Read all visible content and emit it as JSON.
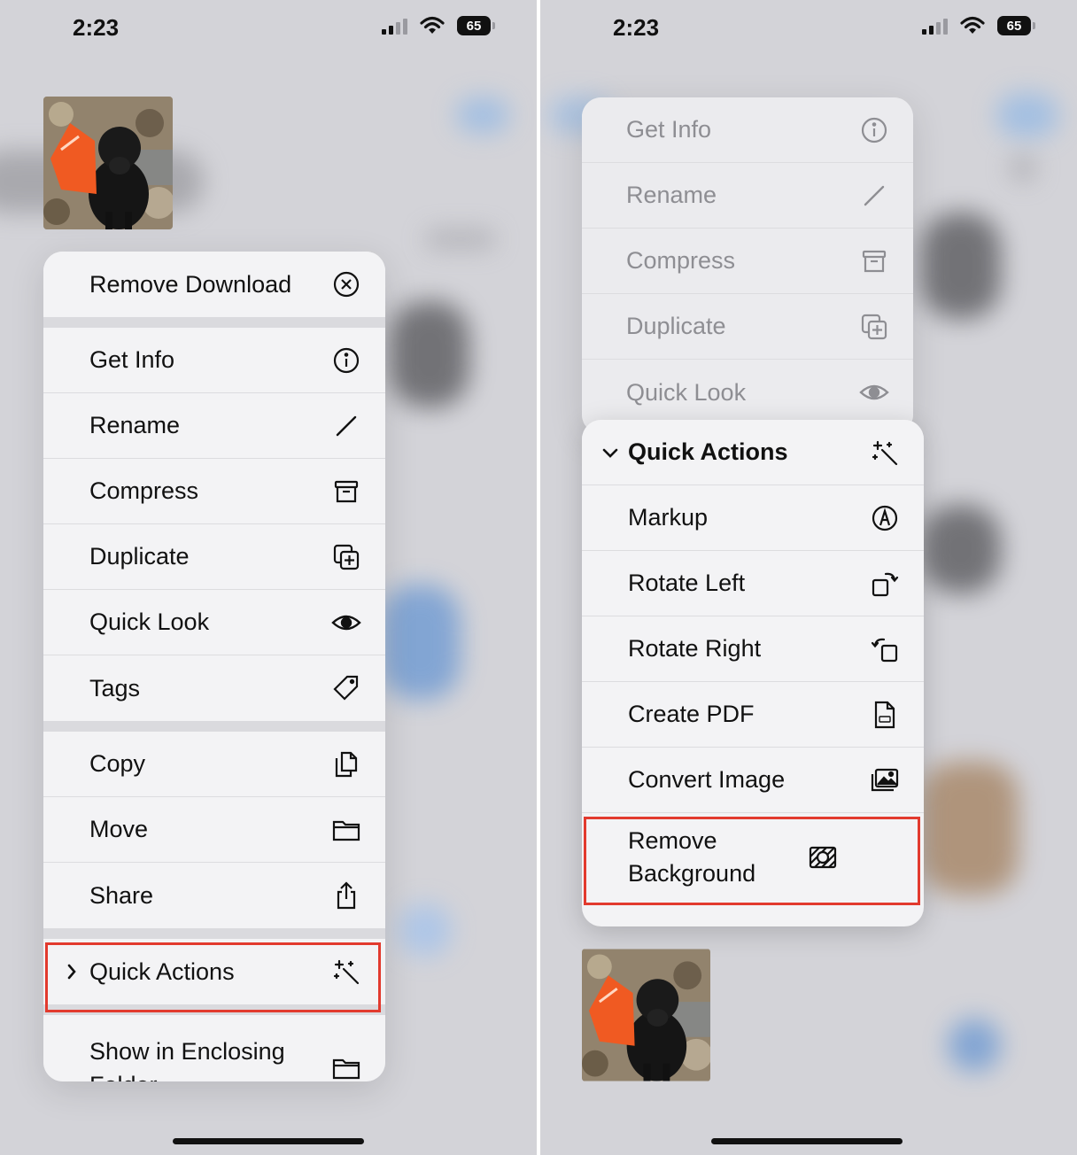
{
  "status_bar": {
    "time": "2:23",
    "battery": "65"
  },
  "left_menu": {
    "items": [
      {
        "label": "Remove Download",
        "icon": "xmark-circle-icon"
      },
      {
        "label": "Get Info",
        "icon": "info-icon"
      },
      {
        "label": "Rename",
        "icon": "pencil-icon"
      },
      {
        "label": "Compress",
        "icon": "archive-box-icon"
      },
      {
        "label": "Duplicate",
        "icon": "duplicate-icon"
      },
      {
        "label": "Quick Look",
        "icon": "eye-icon"
      },
      {
        "label": "Tags",
        "icon": "tag-icon"
      },
      {
        "label": "Copy",
        "icon": "copy-icon"
      },
      {
        "label": "Move",
        "icon": "folder-icon"
      },
      {
        "label": "Share",
        "icon": "share-icon"
      },
      {
        "label": "Quick Actions",
        "icon": "sparkles-icon"
      },
      {
        "label": "Show in Enclosing Folder",
        "icon": "folder-icon"
      }
    ]
  },
  "right_menu": {
    "top_items": [
      {
        "label": "Get Info",
        "icon": "info-icon"
      },
      {
        "label": "Rename",
        "icon": "pencil-icon"
      },
      {
        "label": "Compress",
        "icon": "archive-box-icon"
      },
      {
        "label": "Duplicate",
        "icon": "duplicate-icon"
      },
      {
        "label": "Quick Look",
        "icon": "eye-icon"
      }
    ],
    "submenu_title": "Quick Actions",
    "submenu_items": [
      {
        "label": "Markup",
        "icon": "markup-pen-icon"
      },
      {
        "label": "Rotate Left",
        "icon": "rotate-left-icon"
      },
      {
        "label": "Rotate Right",
        "icon": "rotate-right-icon"
      },
      {
        "label": "Create PDF",
        "icon": "pdf-doc-icon"
      },
      {
        "label": "Convert Image",
        "icon": "photos-icon"
      },
      {
        "label": "Remove Background",
        "icon": "remove-background-icon"
      }
    ]
  },
  "colors": {
    "highlight": "#e23a2e",
    "menu_bg": "#f3f3f5",
    "backdrop": "#d3d3d8"
  }
}
